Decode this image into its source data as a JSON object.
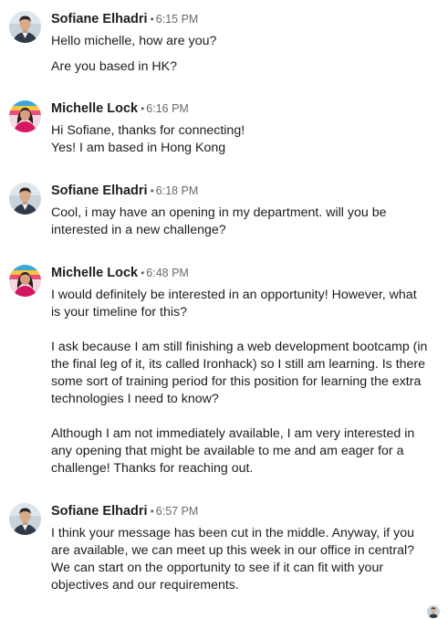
{
  "messages": [
    {
      "sender": "Sofiane Elhadri",
      "separator": "•",
      "time": "6:15 PM",
      "avatar": "man-avatar",
      "paragraphs": [
        "Hello michelle, how are you?",
        "Are you based in HK?"
      ]
    },
    {
      "sender": "Michelle Lock",
      "separator": "•",
      "time": "6:16 PM",
      "avatar": "woman-avatar",
      "paragraphs": [
        "Hi Sofiane, thanks for connecting!\nYes! I am based in Hong Kong"
      ]
    },
    {
      "sender": "Sofiane Elhadri",
      "separator": "•",
      "time": "6:18 PM",
      "avatar": "man-avatar",
      "paragraphs": [
        "Cool, i may have an opening in my department. will you be\ninterested in a new challenge?"
      ]
    },
    {
      "sender": "Michelle Lock",
      "separator": "•",
      "time": "6:48 PM",
      "avatar": "woman-avatar",
      "paragraphs": [
        "I would definitely be interested in an opportunity! However, what\nis your timeline for this?",
        "I ask because I am still finishing a web development bootcamp (in\nthe final leg of it, its called Ironhack) so I still am learning. Is there\nsome sort of training period for this position for learning the extra\ntechnologies I need to know?",
        "Although I am not immediately available, I am very interested in\nany opening that might be available to me and am eager for a\nchallenge! Thanks for reaching out."
      ]
    },
    {
      "sender": "Sofiane Elhadri",
      "separator": "•",
      "time": "6:57 PM",
      "avatar": "man-avatar",
      "paragraphs": [
        "I think your message has been cut in the middle. Anyway, if you\nare available, we can meet up this week in our office in central?\nWe can start on the opportunity to see if it can fit with your\nobjectives and our requirements."
      ]
    }
  ],
  "read_receipt": {
    "avatar": "man-avatar"
  },
  "colors": {
    "text": "#1d1d1d",
    "meta": "#6a6a6a",
    "background": "#ffffff"
  }
}
